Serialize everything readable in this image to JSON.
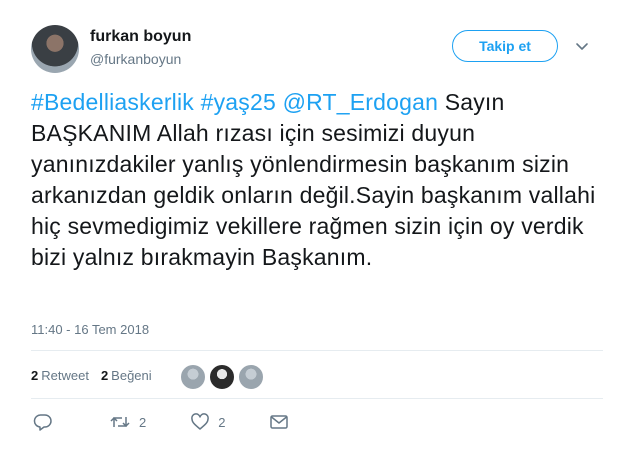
{
  "user": {
    "name": "furkan boyun",
    "handle": "@furkanboyun",
    "follow_label": "Takip et"
  },
  "tweet": {
    "hashtag1": "#Bedelliaskerlik",
    "hashtag2": "#yaş25",
    "mention": "@RT_Erdogan",
    "text_after": "Sayın BAŞKANIM Allah rızası için sesimizi duyun yanınızdakiler yanlış yönlendirmesin başkanım sizin arkanızdan geldik onların değil.Sayin başkanım vallahi hiç sevmedigimiz vekillere rağmen sizin için oy verdik bizi yalnız bırakmayin Başkanım.",
    "timestamp": "11:40 - 16 Tem 2018"
  },
  "stats": {
    "retweet_count": "2",
    "retweet_label": "Retweet",
    "like_count": "2",
    "like_label": "Beğeni"
  },
  "actions": {
    "reply_icon": "reply-icon",
    "retweet_icon": "retweet-icon",
    "retweet_count": "2",
    "like_icon": "heart-icon",
    "like_count": "2",
    "message_icon": "envelope-icon"
  },
  "colors": {
    "accent": "#1da1f2",
    "secondary_text": "#657786",
    "divider": "#e6ecf0"
  }
}
